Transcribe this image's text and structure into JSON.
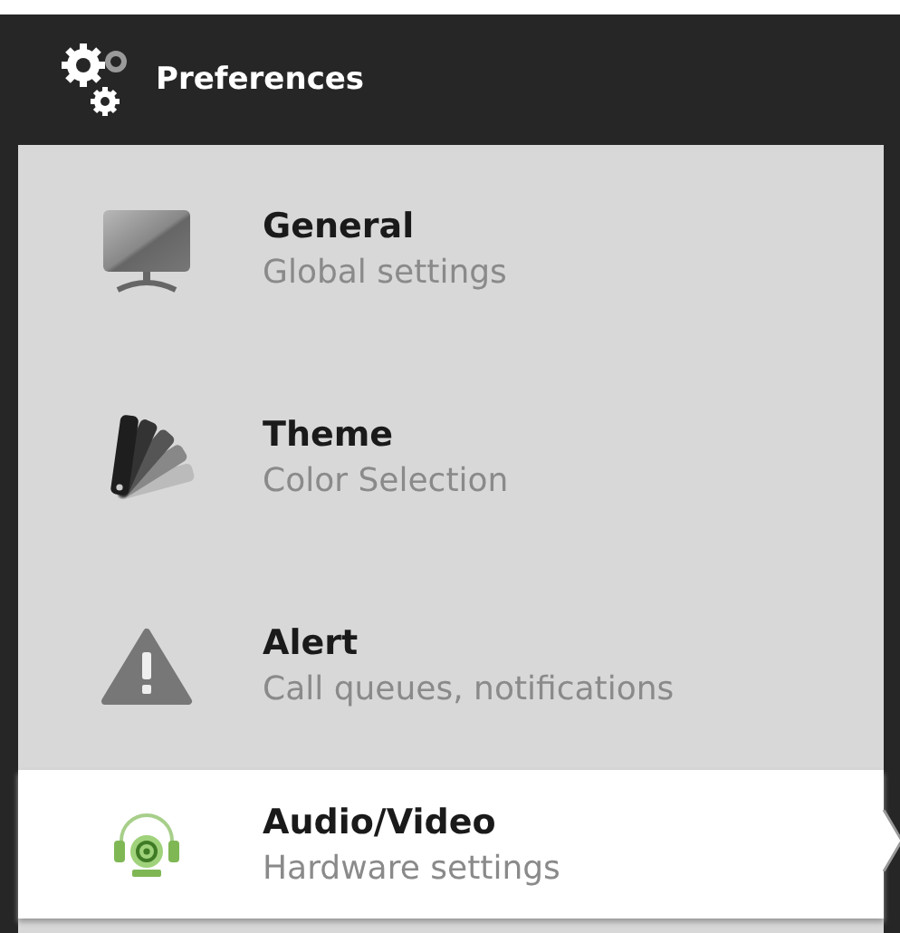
{
  "header": {
    "title": "Preferences"
  },
  "menu": [
    {
      "title": "General",
      "subtitle": "Global settings",
      "selected": false
    },
    {
      "title": "Theme",
      "subtitle": "Color Selection",
      "selected": false
    },
    {
      "title": "Alert",
      "subtitle": "Call queues, notifications",
      "selected": false
    },
    {
      "title": "Audio/Video",
      "subtitle": "Hardware settings",
      "selected": true
    }
  ]
}
